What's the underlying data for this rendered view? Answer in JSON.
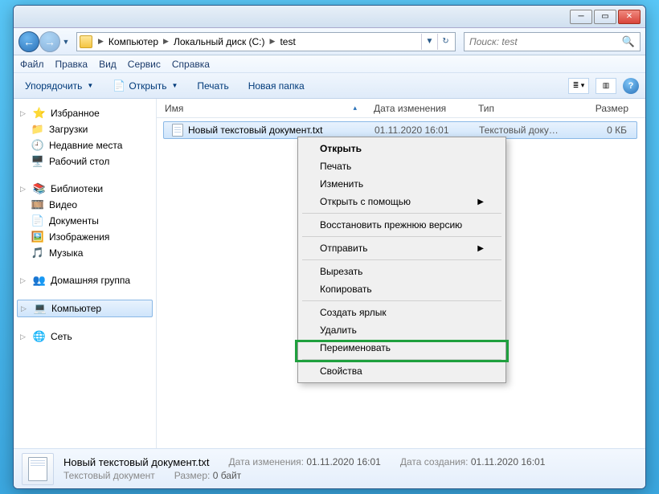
{
  "breadcrumb": {
    "root": "Компьютер",
    "level1": "Локальный диск (C:)",
    "level2": "test"
  },
  "search": {
    "placeholder": "Поиск: test"
  },
  "menu": {
    "file": "Файл",
    "edit": "Правка",
    "view": "Вид",
    "tools": "Сервис",
    "help": "Справка"
  },
  "toolbar": {
    "organize": "Упорядочить",
    "open": "Открыть",
    "print": "Печать",
    "newfolder": "Новая папка"
  },
  "columns": {
    "name": "Имя",
    "date": "Дата изменения",
    "type": "Тип",
    "size": "Размер"
  },
  "file": {
    "name": "Новый текстовый документ.txt",
    "date": "01.11.2020 16:01",
    "type": "Текстовый докум...",
    "size": "0 КБ"
  },
  "sidebar": {
    "favorites": {
      "label": "Избранное",
      "downloads": "Загрузки",
      "recent": "Недавние места",
      "desktop": "Рабочий стол"
    },
    "libraries": {
      "label": "Библиотеки",
      "video": "Видео",
      "documents": "Документы",
      "pictures": "Изображения",
      "music": "Музыка"
    },
    "homegroup": "Домашняя группа",
    "computer": "Компьютер",
    "network": "Сеть"
  },
  "context": {
    "open": "Открыть",
    "print": "Печать",
    "edit": "Изменить",
    "openwith": "Открыть с помощью",
    "restore": "Восстановить прежнюю версию",
    "sendto": "Отправить",
    "cut": "Вырезать",
    "copy": "Копировать",
    "shortcut": "Создать ярлык",
    "delete": "Удалить",
    "rename": "Переименовать",
    "properties": "Свойства"
  },
  "status": {
    "title": "Новый текстовый документ.txt",
    "subtitle": "Текстовый документ",
    "modified_lbl": "Дата изменения:",
    "modified": "01.11.2020 16:01",
    "created_lbl": "Дата создания:",
    "created": "01.11.2020 16:01",
    "size_lbl": "Размер:",
    "size": "0 байт"
  }
}
